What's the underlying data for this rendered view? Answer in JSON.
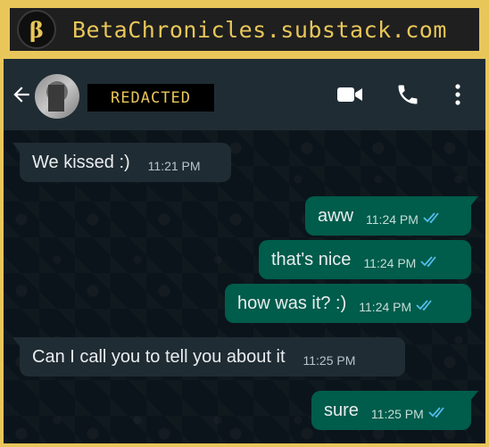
{
  "banner": {
    "logo_glyph": "β",
    "site": "BetaChronicles.substack.com",
    "accent": "#e8c65a"
  },
  "header": {
    "back_icon": "arrow-left-icon",
    "contact_name": "REDACTED",
    "video_icon": "video-camera-icon",
    "call_icon": "phone-icon",
    "menu_icon": "more-vertical-icon"
  },
  "messages": [
    {
      "direction": "in",
      "text": "We kissed :)",
      "time": "11:21 PM"
    },
    {
      "direction": "out",
      "text": "aww",
      "time": "11:24 PM",
      "status": "read"
    },
    {
      "direction": "out",
      "text": "that's nice",
      "time": "11:24 PM",
      "status": "read"
    },
    {
      "direction": "out",
      "text": "how was it? :)",
      "time": "11:24 PM",
      "status": "read"
    },
    {
      "direction": "in",
      "text": "Can I call you to tell you about it",
      "time": "11:25 PM"
    },
    {
      "direction": "out",
      "text": "sure",
      "time": "11:25 PM",
      "status": "read"
    }
  ],
  "colors": {
    "header_bg": "#1f2c34",
    "chat_bg": "#0b141a",
    "incoming_bubble": "#202c33",
    "outgoing_bubble": "#005c4b",
    "read_ticks": "#53bdeb"
  }
}
